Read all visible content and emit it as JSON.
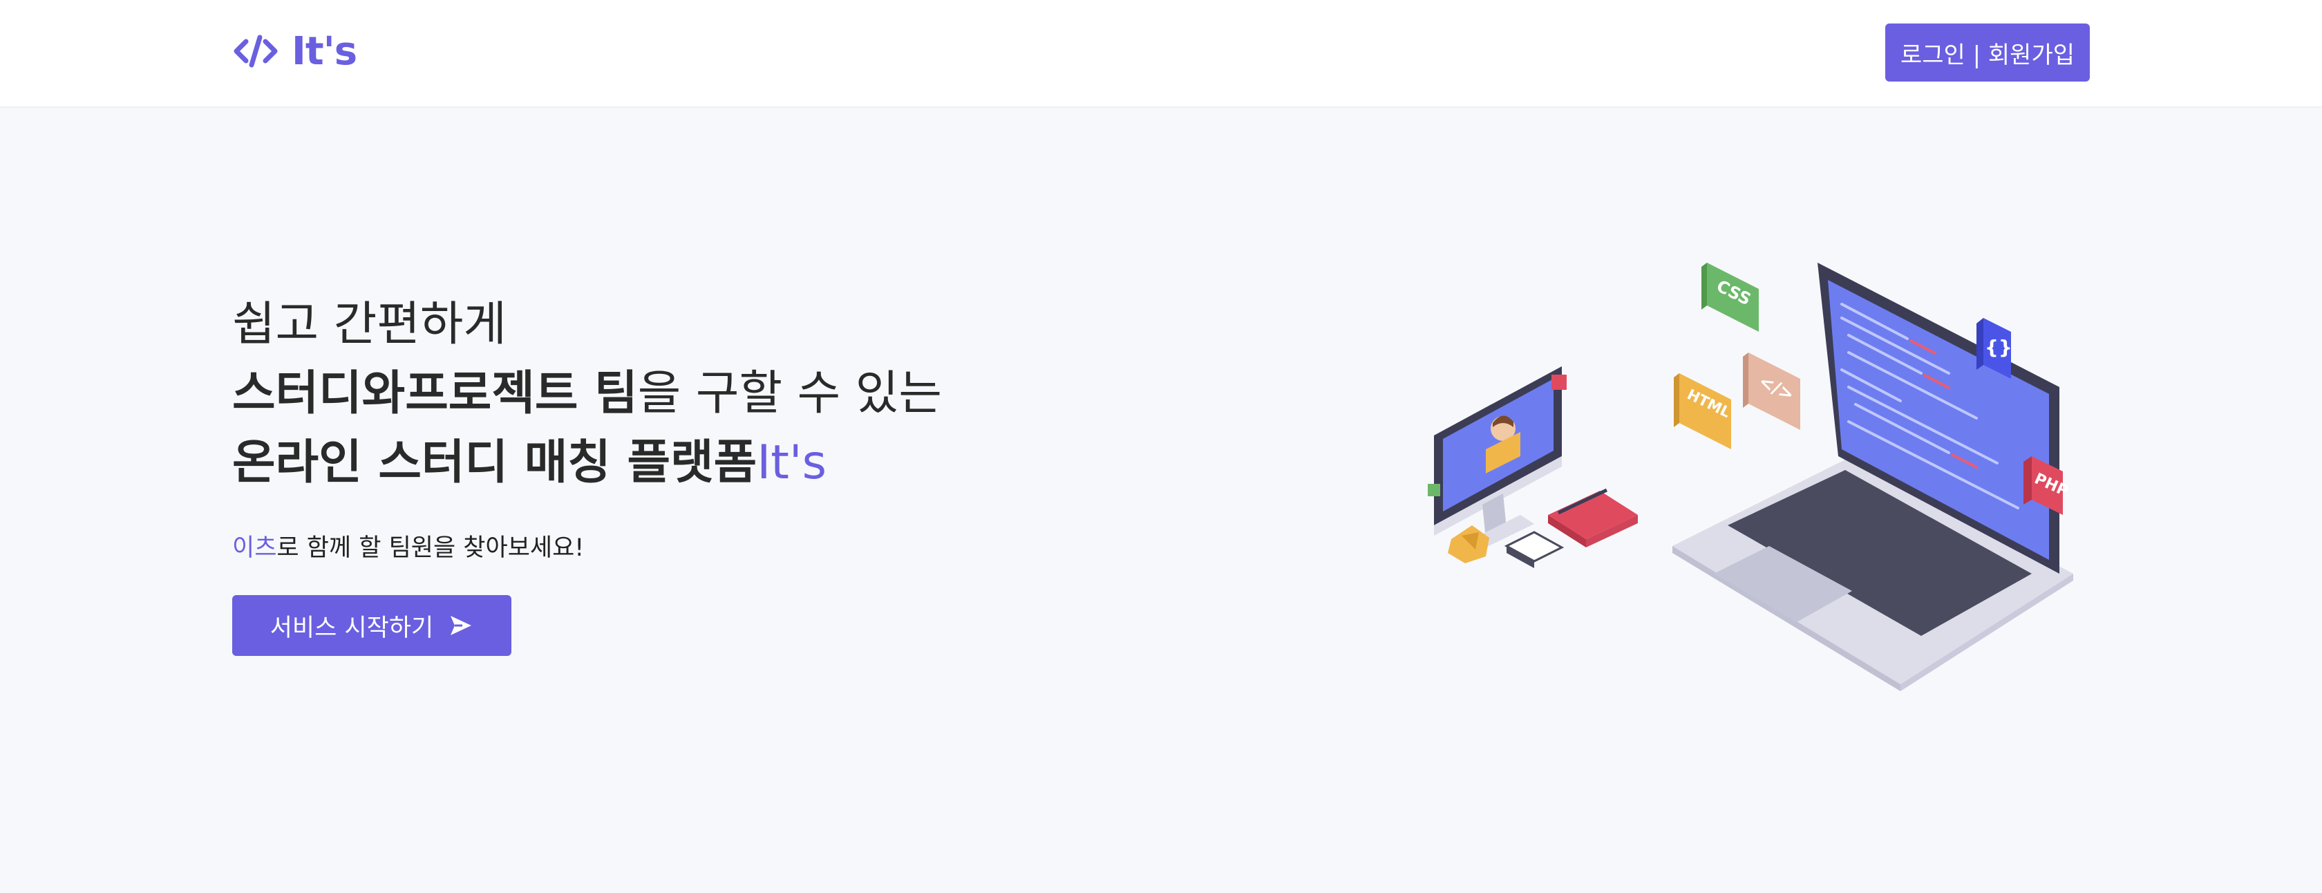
{
  "header": {
    "logo_icon": "code-brackets-icon",
    "logo_text": "It's",
    "auth_label": "로그인 | 회원가입"
  },
  "hero": {
    "line1": "쉽고 간편하게",
    "line2_bold": "스터디와프로젝트 팀",
    "line2_rest": "을 구할 수 있는",
    "line3_bold": "온라인 스터디 매칭 플랫폼",
    "line3_accent": "It's",
    "sub_accent": "이츠",
    "sub_rest": "로 함께 할 팀원을 찾아보세요!",
    "cta_label": "서비스 시작하기",
    "cta_icon": "send-icon"
  },
  "illustration": {
    "badges": [
      "CSS",
      "HTML",
      "PHP",
      "{}",
      "</>"
    ]
  },
  "colors": {
    "accent": "#6a5fe0",
    "background": "#f7f8fb"
  }
}
